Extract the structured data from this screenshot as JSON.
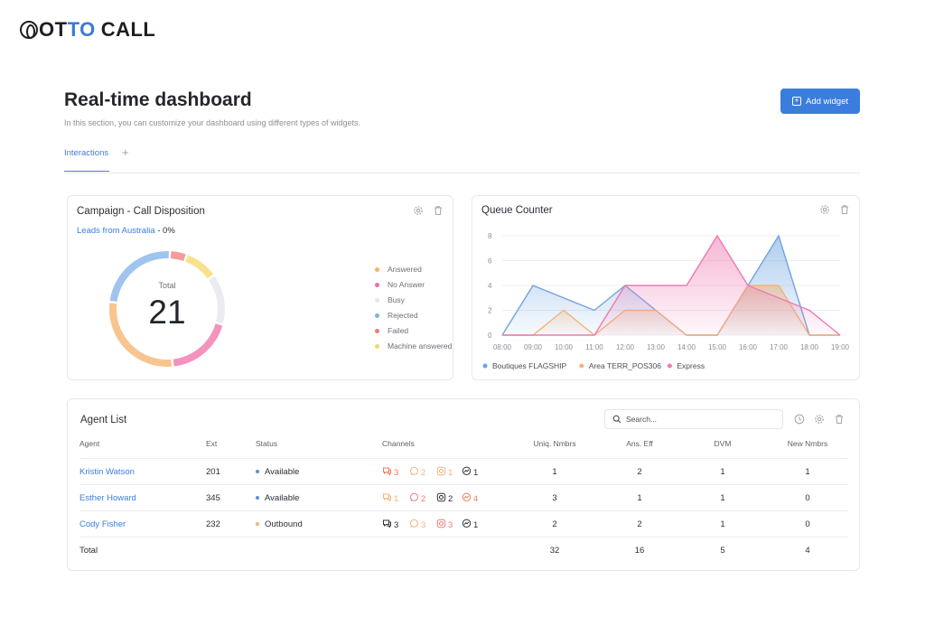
{
  "brand": {
    "part1": "OT",
    "part2": "TO",
    "part3": "CALL"
  },
  "header": {
    "title": "Real-time dashboard",
    "subtitle": "In this section, you can customize your dashboard using different types of widgets.",
    "add_widget_label": "Add widget"
  },
  "tabs": [
    {
      "label": "Interactions",
      "active": true
    }
  ],
  "tab_add_symbol": "+",
  "disposition": {
    "title": "Campaign - Call Disposition",
    "campaign_link": "Leads from Australia",
    "campaign_pct": " - 0%",
    "total_label": "Total",
    "total_value": "21",
    "items": [
      {
        "label": "Answered",
        "value": 6,
        "color": "#f6b26b"
      },
      {
        "label": "No Answer",
        "value": 4,
        "color": "#f06fa8"
      },
      {
        "label": "Busy",
        "value": 3,
        "color": "#e4e6ea"
      },
      {
        "label": "Rejected",
        "value": 5,
        "color": "#7fb0ea"
      },
      {
        "label": "Failed",
        "value": 1,
        "color": "#f07a7a"
      },
      {
        "label": "Machine answered",
        "value": 2,
        "color": "#f5d867"
      }
    ]
  },
  "queue": {
    "title": "Queue Counter",
    "chart_data": {
      "type": "area",
      "x": [
        "08:00",
        "09:00",
        "10:00",
        "11:00",
        "12:00",
        "13:00",
        "14:00",
        "15:00",
        "16:00",
        "17:00",
        "18:00",
        "19:00"
      ],
      "ylim": [
        0,
        8
      ],
      "yticks": [
        0,
        2,
        4,
        6,
        8
      ],
      "series": [
        {
          "name": "Boutiques FLAGSHIP",
          "color": "#6fa3e0",
          "values": [
            0,
            4,
            3,
            2,
            4,
            2,
            0,
            0,
            4,
            8,
            0,
            0
          ]
        },
        {
          "name": "Area TERR_POS306",
          "color": "#f2b37a",
          "values": [
            0,
            0,
            2,
            0,
            2,
            2,
            0,
            0,
            4,
            4,
            0,
            0
          ]
        },
        {
          "name": "Express",
          "color": "#ef7ab3",
          "values": [
            0,
            0,
            0,
            0,
            4,
            4,
            4,
            8,
            4,
            3,
            2,
            0
          ]
        }
      ]
    }
  },
  "agents": {
    "title": "Agent List",
    "search_placeholder": "Search...",
    "columns": [
      "Agent",
      "Ext",
      "Status",
      "Channels",
      "Uniq. Nmbrs",
      "Ans. Eff",
      "DVM",
      "New Nmbrs"
    ],
    "rows": [
      {
        "name": "Kristin Watson",
        "ext": "201",
        "status": "Available",
        "status_color": "#5b8fd8",
        "channels": [
          {
            "icon": "chat-icon",
            "count": "3",
            "color": "#f07a5a"
          },
          {
            "icon": "whatsapp-icon",
            "count": "2",
            "color": "#f2b37a"
          },
          {
            "icon": "instagram-icon",
            "count": "1",
            "color": "#f2b37a"
          },
          {
            "icon": "messenger-icon",
            "count": "1",
            "color": "#2b2f36"
          }
        ],
        "uniq": "1",
        "ans_eff": "2",
        "dvm": "1",
        "new_nmbrs": "1"
      },
      {
        "name": "Esther Howard",
        "ext": "345",
        "status": "Available",
        "status_color": "#5b8fd8",
        "channels": [
          {
            "icon": "chat-icon",
            "count": "1",
            "color": "#f2b37a"
          },
          {
            "icon": "whatsapp-icon",
            "count": "2",
            "color": "#f07a7a"
          },
          {
            "icon": "instagram-icon",
            "count": "2",
            "color": "#2b2f36"
          },
          {
            "icon": "messenger-icon",
            "count": "4",
            "color": "#f07a5a"
          }
        ],
        "uniq": "3",
        "ans_eff": "1",
        "dvm": "1",
        "new_nmbrs": "0"
      },
      {
        "name": "Cody Fisher",
        "ext": "232",
        "status": "Outbound",
        "status_color": "#f2b37a",
        "channels": [
          {
            "icon": "chat-icon",
            "count": "3",
            "color": "#2b2f36"
          },
          {
            "icon": "whatsapp-icon",
            "count": "3",
            "color": "#f2b37a"
          },
          {
            "icon": "instagram-icon",
            "count": "3",
            "color": "#f07a7a"
          },
          {
            "icon": "messenger-icon",
            "count": "1",
            "color": "#2b2f36"
          }
        ],
        "uniq": "2",
        "ans_eff": "2",
        "dvm": "1",
        "new_nmbrs": "0"
      }
    ],
    "total": {
      "label": "Total",
      "uniq": "32",
      "ans_eff": "16",
      "dvm": "5",
      "new_nmbrs": "4"
    }
  }
}
